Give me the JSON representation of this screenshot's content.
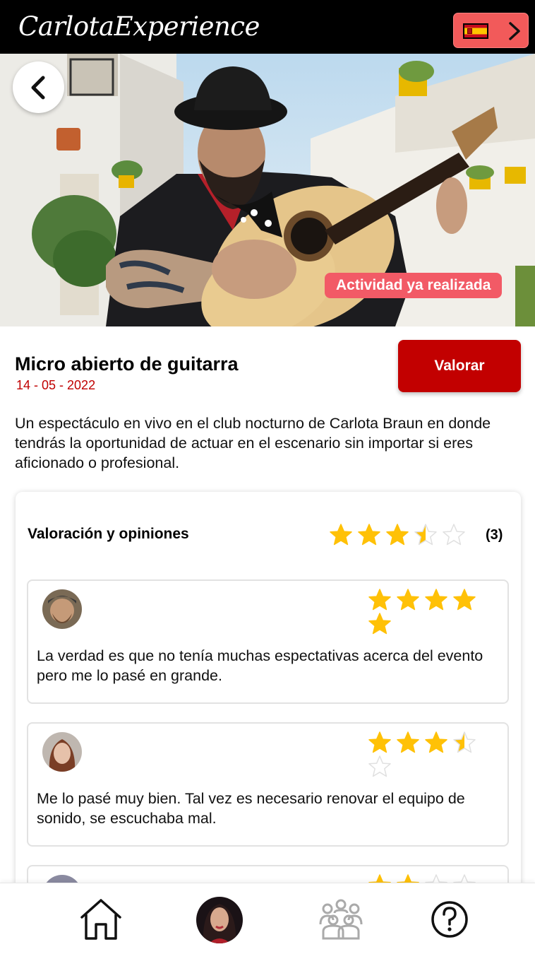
{
  "header": {
    "logo_text": "CarlotaExperience",
    "language": {
      "flag_icon": "spain-flag-icon",
      "chevron_icon": "chevron-right-icon"
    }
  },
  "hero": {
    "image_description_icon": "guitarist-photo",
    "badge": "Actividad ya realizada"
  },
  "activity": {
    "title": "Micro abierto de guitarra",
    "date": "14 - 05 - 2022",
    "rate_button": "Valorar",
    "description": "Un espectáculo en vivo en el club nocturno de Carlota Braun en donde tendrás la oportunidad de actuar en el escenario sin importar si eres aficionado o profesional."
  },
  "reviews": {
    "heading": "Valoración y opiniones",
    "average_rating": 3.5,
    "max_rating": 5,
    "count_label": "(3)",
    "items": [
      {
        "rating": 5,
        "text": "La verdad es que no tenía muchas espectativas acerca del evento pero me lo pasé en grande."
      },
      {
        "rating": 3.5,
        "text": "Me lo pasé muy bien. Tal vez es necesario renovar el equipo de sonido, se escuchaba mal."
      },
      {
        "rating": 2,
        "text": ""
      }
    ]
  },
  "bottom_nav": {
    "items": [
      "home-icon",
      "profile-avatar",
      "community-icon",
      "help-icon"
    ]
  },
  "colors": {
    "header_bg": "#000000",
    "accent_red": "#c20000",
    "badge_red": "#f25a66",
    "star_gold": "#ffc107",
    "star_empty": "#e0e0e0"
  }
}
